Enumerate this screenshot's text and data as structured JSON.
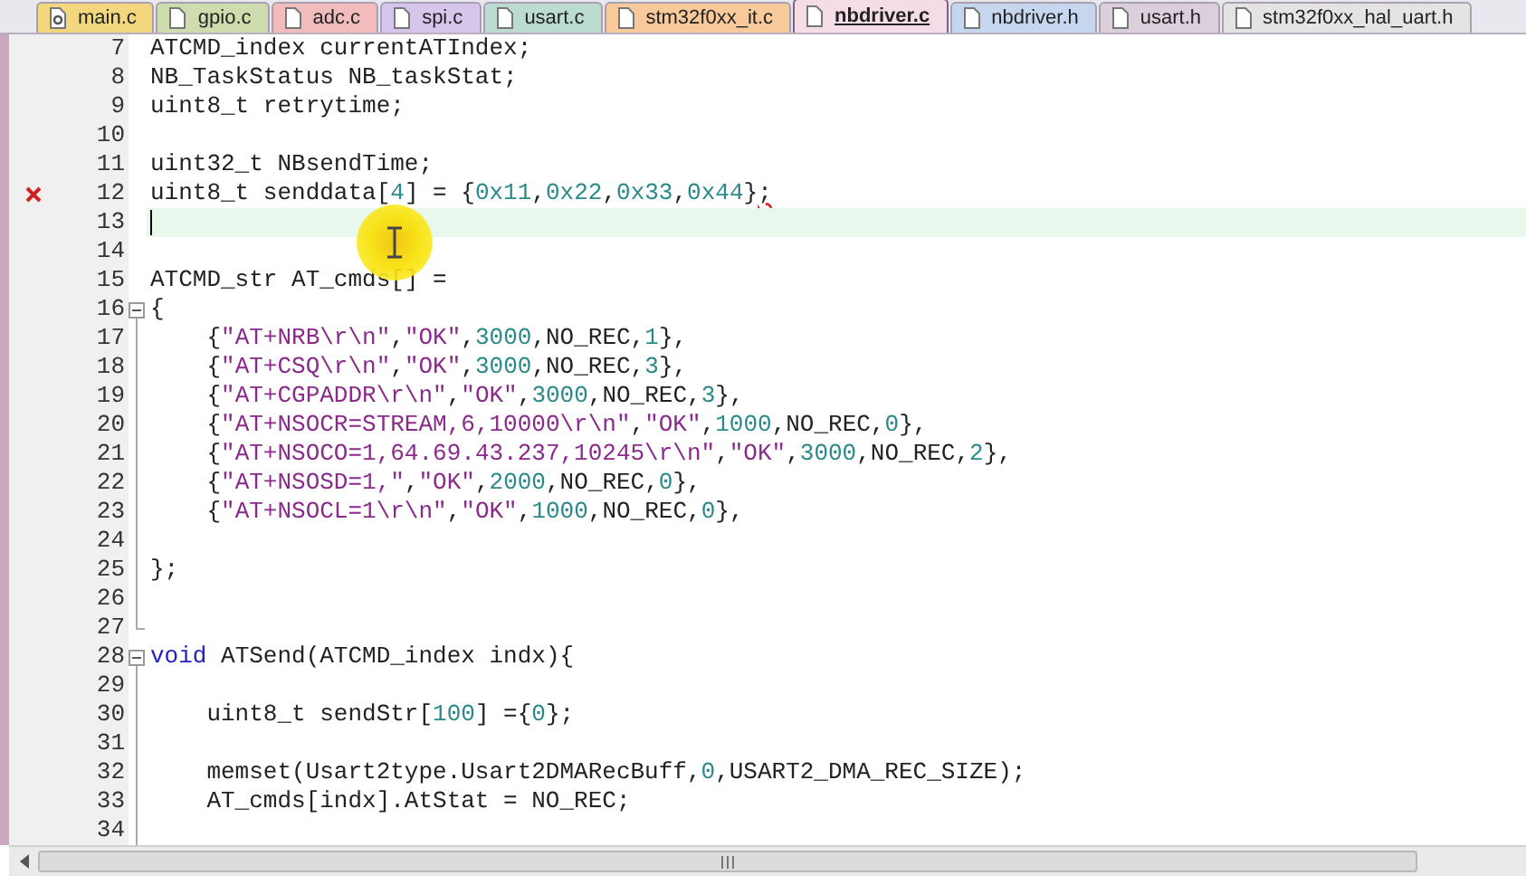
{
  "tabs": [
    {
      "label": "main.c",
      "selected": false,
      "color": "#f3d77e",
      "kind": "gear"
    },
    {
      "label": "gpio.c",
      "selected": false,
      "color": "#cfdcae",
      "kind": "file"
    },
    {
      "label": "adc.c",
      "selected": false,
      "color": "#f2bcbc",
      "kind": "file"
    },
    {
      "label": "spi.c",
      "selected": false,
      "color": "#d6c6ec",
      "kind": "file"
    },
    {
      "label": "usart.c",
      "selected": false,
      "color": "#bcdcd2",
      "kind": "file"
    },
    {
      "label": "stm32f0xx_it.c",
      "selected": false,
      "color": "#f8c99a",
      "kind": "file"
    },
    {
      "label": "nbdriver.c",
      "selected": true,
      "color": "#f4dde6",
      "kind": "file"
    },
    {
      "label": "nbdriver.h",
      "selected": false,
      "color": "#c6d6ee",
      "kind": "file"
    },
    {
      "label": "usart.h",
      "selected": false,
      "color": "#dccfdc",
      "kind": "file"
    },
    {
      "label": "stm32f0xx_hal_uart.h",
      "selected": false,
      "color": "#e4e4e4",
      "kind": "file"
    }
  ],
  "lines": [
    {
      "number": "7",
      "error": false,
      "current": false,
      "kind": "plain",
      "tokens": [
        {
          "kind": "plain",
          "text": "ATCMD_index currentATIndex;"
        }
      ]
    },
    {
      "number": "8",
      "error": false,
      "current": false,
      "kind": "plain",
      "tokens": [
        {
          "kind": "plain",
          "text": "NB_TaskStatus NB_taskStat;"
        }
      ]
    },
    {
      "number": "9",
      "error": false,
      "current": false,
      "kind": "plain",
      "tokens": [
        {
          "kind": "plain",
          "text": "uint8_t retrytime;"
        }
      ]
    },
    {
      "number": "10",
      "error": false,
      "current": false,
      "kind": "plain"
    },
    {
      "number": "11",
      "error": false,
      "current": false,
      "kind": "plain",
      "tokens": [
        {
          "kind": "plain",
          "text": "uint32_t NBsendTime;"
        }
      ]
    },
    {
      "number": "12",
      "error": true,
      "current": false,
      "kind": "plain",
      "tokens": [
        {
          "kind": "plain",
          "text": "uint8_t senddata["
        },
        {
          "kind": "number",
          "text": "4"
        },
        {
          "kind": "plain",
          "text": "] = {"
        },
        {
          "kind": "number",
          "text": "0x11"
        },
        {
          "kind": "plain",
          "text": ","
        },
        {
          "kind": "number",
          "text": "0x22"
        },
        {
          "kind": "plain",
          "text": ","
        },
        {
          "kind": "number",
          "text": "0x33"
        },
        {
          "kind": "plain",
          "text": ","
        },
        {
          "kind": "number",
          "text": "0x44"
        },
        {
          "kind": "plain",
          "text": "}"
        },
        {
          "kind": "squiggle",
          "text": ";"
        }
      ]
    },
    {
      "number": "13",
      "error": false,
      "current": true,
      "kind": "plain"
    },
    {
      "number": "14",
      "error": false,
      "current": false,
      "kind": "plain"
    },
    {
      "number": "15",
      "error": false,
      "current": false,
      "kind": "plain",
      "tokens": [
        {
          "kind": "plain",
          "text": "ATCMD_str AT_cmds[] ="
        }
      ]
    },
    {
      "number": "16",
      "error": false,
      "current": false,
      "kind": "fold_start",
      "tokens": [
        {
          "kind": "plain",
          "text": "{"
        }
      ]
    },
    {
      "number": "17",
      "error": false,
      "current": false,
      "kind": "fold_body",
      "tokens": [
        {
          "kind": "plain",
          "text": "    {"
        },
        {
          "kind": "string",
          "text": "\"AT+NRB\\r\\n\""
        },
        {
          "kind": "plain",
          "text": ","
        },
        {
          "kind": "string",
          "text": "\"OK\""
        },
        {
          "kind": "plain",
          "text": ","
        },
        {
          "kind": "number",
          "text": "3000"
        },
        {
          "kind": "plain",
          "text": ",NO_REC,"
        },
        {
          "kind": "number",
          "text": "1"
        },
        {
          "kind": "plain",
          "text": "},"
        }
      ]
    },
    {
      "number": "18",
      "error": false,
      "current": false,
      "kind": "fold_body",
      "tokens": [
        {
          "kind": "plain",
          "text": "    {"
        },
        {
          "kind": "string",
          "text": "\"AT+CSQ\\r\\n\""
        },
        {
          "kind": "plain",
          "text": ","
        },
        {
          "kind": "string",
          "text": "\"OK\""
        },
        {
          "kind": "plain",
          "text": ","
        },
        {
          "kind": "number",
          "text": "3000"
        },
        {
          "kind": "plain",
          "text": ",NO_REC,"
        },
        {
          "kind": "number",
          "text": "3"
        },
        {
          "kind": "plain",
          "text": "},"
        }
      ]
    },
    {
      "number": "19",
      "error": false,
      "current": false,
      "kind": "fold_body",
      "tokens": [
        {
          "kind": "plain",
          "text": "    {"
        },
        {
          "kind": "string",
          "text": "\"AT+CGPADDR\\r\\n\""
        },
        {
          "kind": "plain",
          "text": ","
        },
        {
          "kind": "string",
          "text": "\"OK\""
        },
        {
          "kind": "plain",
          "text": ","
        },
        {
          "kind": "number",
          "text": "3000"
        },
        {
          "kind": "plain",
          "text": ",NO_REC,"
        },
        {
          "kind": "number",
          "text": "3"
        },
        {
          "kind": "plain",
          "text": "},"
        }
      ]
    },
    {
      "number": "20",
      "error": false,
      "current": false,
      "kind": "fold_body",
      "tokens": [
        {
          "kind": "plain",
          "text": "    {"
        },
        {
          "kind": "string",
          "text": "\"AT+NSOCR=STREAM,6,10000\\r\\n\""
        },
        {
          "kind": "plain",
          "text": ","
        },
        {
          "kind": "string",
          "text": "\"OK\""
        },
        {
          "kind": "plain",
          "text": ","
        },
        {
          "kind": "number",
          "text": "1000"
        },
        {
          "kind": "plain",
          "text": ",NO_REC,"
        },
        {
          "kind": "number",
          "text": "0"
        },
        {
          "kind": "plain",
          "text": "},"
        }
      ]
    },
    {
      "number": "21",
      "error": false,
      "current": false,
      "kind": "fold_body",
      "tokens": [
        {
          "kind": "plain",
          "text": "    {"
        },
        {
          "kind": "string",
          "text": "\"AT+NSOCO=1,64.69.43.237,10245\\r\\n\""
        },
        {
          "kind": "plain",
          "text": ","
        },
        {
          "kind": "string",
          "text": "\"OK\""
        },
        {
          "kind": "plain",
          "text": ","
        },
        {
          "kind": "number",
          "text": "3000"
        },
        {
          "kind": "plain",
          "text": ",NO_REC,"
        },
        {
          "kind": "number",
          "text": "2"
        },
        {
          "kind": "plain",
          "text": "},"
        }
      ]
    },
    {
      "number": "22",
      "error": false,
      "current": false,
      "kind": "fold_body",
      "tokens": [
        {
          "kind": "plain",
          "text": "    {"
        },
        {
          "kind": "string",
          "text": "\"AT+NSOSD=1,\""
        },
        {
          "kind": "plain",
          "text": ","
        },
        {
          "kind": "string",
          "text": "\"OK\""
        },
        {
          "kind": "plain",
          "text": ","
        },
        {
          "kind": "number",
          "text": "2000"
        },
        {
          "kind": "plain",
          "text": ",NO_REC,"
        },
        {
          "kind": "number",
          "text": "0"
        },
        {
          "kind": "plain",
          "text": "},"
        }
      ]
    },
    {
      "number": "23",
      "error": false,
      "current": false,
      "kind": "fold_body",
      "tokens": [
        {
          "kind": "plain",
          "text": "    {"
        },
        {
          "kind": "string",
          "text": "\"AT+NSOCL=1\\r\\n\""
        },
        {
          "kind": "plain",
          "text": ","
        },
        {
          "kind": "string",
          "text": "\"OK\""
        },
        {
          "kind": "plain",
          "text": ","
        },
        {
          "kind": "number",
          "text": "1000"
        },
        {
          "kind": "plain",
          "text": ",NO_REC,"
        },
        {
          "kind": "number",
          "text": "0"
        },
        {
          "kind": "plain",
          "text": "},"
        }
      ]
    },
    {
      "number": "24",
      "error": false,
      "current": false,
      "kind": "fold_body"
    },
    {
      "number": "25",
      "error": false,
      "current": false,
      "kind": "fold_body",
      "tokens": [
        {
          "kind": "plain",
          "text": "};"
        }
      ]
    },
    {
      "number": "26",
      "error": false,
      "current": false,
      "kind": "fold_body"
    },
    {
      "number": "27",
      "error": false,
      "current": false,
      "kind": "fold_end"
    },
    {
      "number": "28",
      "error": false,
      "current": false,
      "kind": "fold_start",
      "tokens": [
        {
          "kind": "keyword",
          "text": "void"
        },
        {
          "kind": "plain",
          "text": " ATSend(ATCMD_index indx){"
        }
      ]
    },
    {
      "number": "29",
      "error": false,
      "current": false,
      "kind": "fold_body"
    },
    {
      "number": "30",
      "error": false,
      "current": false,
      "kind": "fold_body",
      "tokens": [
        {
          "kind": "plain",
          "text": "    uint8_t sendStr["
        },
        {
          "kind": "number",
          "text": "100"
        },
        {
          "kind": "plain",
          "text": "] ={"
        },
        {
          "kind": "number",
          "text": "0"
        },
        {
          "kind": "plain",
          "text": "};"
        }
      ]
    },
    {
      "number": "31",
      "error": false,
      "current": false,
      "kind": "fold_body"
    },
    {
      "number": "32",
      "error": false,
      "current": false,
      "kind": "fold_body",
      "tokens": [
        {
          "kind": "plain",
          "text": "    memset(Usart2type.Usart2DMARecBuff,"
        },
        {
          "kind": "number",
          "text": "0"
        },
        {
          "kind": "plain",
          "text": ",USART2_DMA_REC_SIZE);"
        }
      ]
    },
    {
      "number": "33",
      "error": false,
      "current": false,
      "kind": "fold_body",
      "tokens": [
        {
          "kind": "plain",
          "text": "    AT_cmds[indx].AtStat = NO_REC;"
        }
      ]
    },
    {
      "number": "34",
      "error": false,
      "current": false,
      "kind": "fold_body"
    }
  ]
}
